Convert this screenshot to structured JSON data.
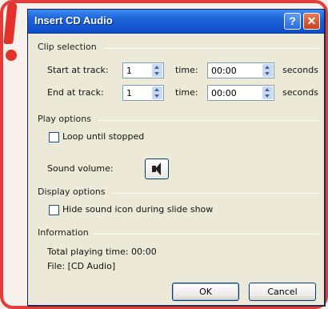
{
  "dialog": {
    "title": "Insert CD Audio",
    "help_glyph": "?",
    "close_glyph": "✕"
  },
  "clip_selection": {
    "header": "Clip selection",
    "start_label": "Start at track:",
    "start_track": "1",
    "start_time_label": "time:",
    "start_time": "00:00",
    "start_units": "seconds",
    "end_label": "End at track:",
    "end_track": "1",
    "end_time_label": "time:",
    "end_time": "00:00",
    "end_units": "seconds"
  },
  "play_options": {
    "header": "Play options",
    "loop_label": "Loop until stopped",
    "loop_checked": false,
    "volume_label": "Sound volume:"
  },
  "display_options": {
    "header": "Display options",
    "hide_icon_label": "Hide sound icon during slide show",
    "hide_icon_checked": false
  },
  "information": {
    "header": "Information",
    "total_time": "Total playing time:  00:00",
    "file": "File:  [CD Audio]"
  },
  "buttons": {
    "ok": "OK",
    "cancel": "Cancel"
  },
  "icons": {
    "help": "help-icon",
    "close": "close-icon",
    "volume": "speaker-icon",
    "callout": "exclamation-icon"
  },
  "colors": {
    "titlebar": "#0b4ec9",
    "frame_accent": "#e43c3a",
    "dialog_bg": "#ece9d8"
  }
}
